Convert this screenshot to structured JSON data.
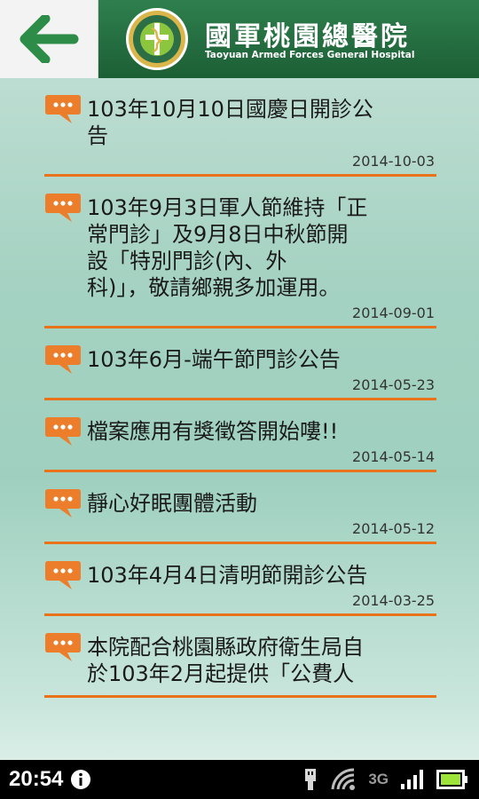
{
  "header": {
    "title": "國軍桃園總醫院",
    "subtitle": "Taoyuan Armed Forces General Hospital",
    "back_icon": "arrow-left-icon",
    "logo_icon": "hospital-emblem-icon",
    "colors": {
      "brand_green": "#1c5f35",
      "arrow_green": "#2d8c47",
      "accent_orange": "#e9731a"
    }
  },
  "announcements": [
    {
      "title": "103年10月10日國慶日開診公\n告",
      "date": "2014-10-03"
    },
    {
      "title": "103年9月3日軍人節維持「正\n常門診」及9月8日中秋節開\n設「特別門診(內、外\n科)」，敬請鄉親多加運用。",
      "date": "2014-09-01"
    },
    {
      "title": "103年6月-端午節門診公告",
      "date": "2014-05-23"
    },
    {
      "title": "檔案應用有獎徵答開始嘍!!",
      "date": "2014-05-14"
    },
    {
      "title": "靜心好眠團體活動",
      "date": "2014-05-12"
    },
    {
      "title": "103年4月4日清明節開診公告",
      "date": "2014-03-25"
    },
    {
      "title": "本院配合桃園縣政府衛生局自\n於103年2月起提供「公費人",
      "date": ""
    }
  ],
  "status_bar": {
    "time": "20:54",
    "network": "3G",
    "icons": [
      "info-icon",
      "usb-icon",
      "wifi-icon",
      "signal-icon",
      "battery-icon"
    ]
  }
}
